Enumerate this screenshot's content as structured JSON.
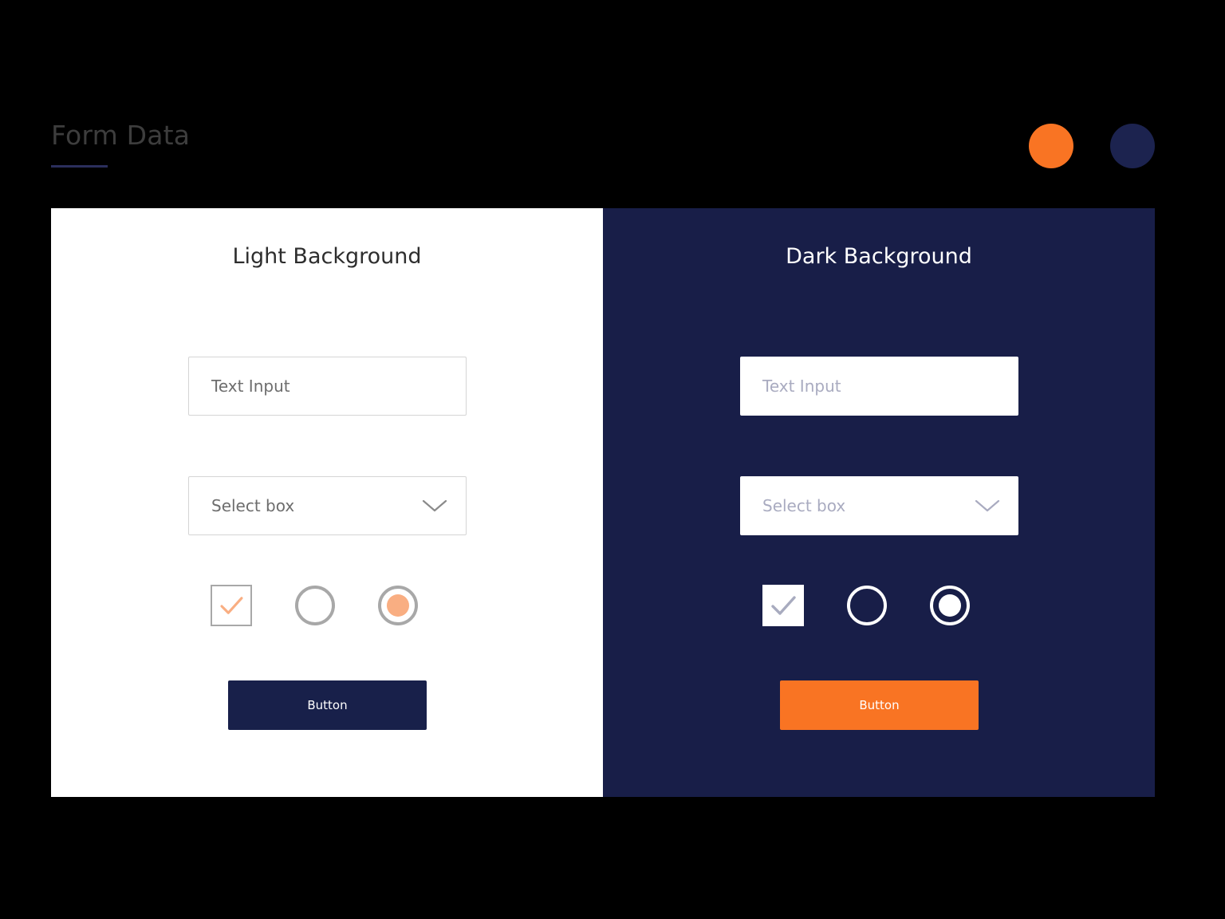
{
  "header": {
    "title": "Form Data",
    "swatches": [
      {
        "name": "orange-swatch",
        "color": "#f97423"
      },
      {
        "name": "navy-swatch",
        "color": "#1c234f"
      }
    ],
    "underline_color": "#2b2f5c"
  },
  "panels": {
    "light": {
      "heading": "Light Background",
      "background": "#ffffff",
      "text_input": {
        "placeholder": "Text Input",
        "value": ""
      },
      "select": {
        "label": "Select box",
        "icon": "chevron-down-icon"
      },
      "checkbox": {
        "checked": true,
        "check_color": "#f9ae82",
        "border_color": "#a8a8a8"
      },
      "radio_empty": {
        "selected": false,
        "ring_color": "#a8a8a8"
      },
      "radio_selected": {
        "selected": true,
        "ring_color": "#a8a8a8",
        "dot_color": "#f9ae82"
      },
      "button": {
        "label": "Button",
        "color": "#18204a"
      }
    },
    "dark": {
      "heading": "Dark Background",
      "background": "#181e48",
      "text_input": {
        "placeholder": "Text Input",
        "value": ""
      },
      "select": {
        "label": "Select box",
        "icon": "chevron-down-icon"
      },
      "checkbox": {
        "checked": true,
        "check_color": "#a8abbf",
        "fill_color": "#ffffff"
      },
      "radio_empty": {
        "selected": false,
        "ring_color": "#ffffff"
      },
      "radio_selected": {
        "selected": true,
        "ring_color": "#ffffff",
        "dot_color": "#ffffff"
      },
      "button": {
        "label": "Button",
        "color": "#f97423"
      }
    }
  }
}
